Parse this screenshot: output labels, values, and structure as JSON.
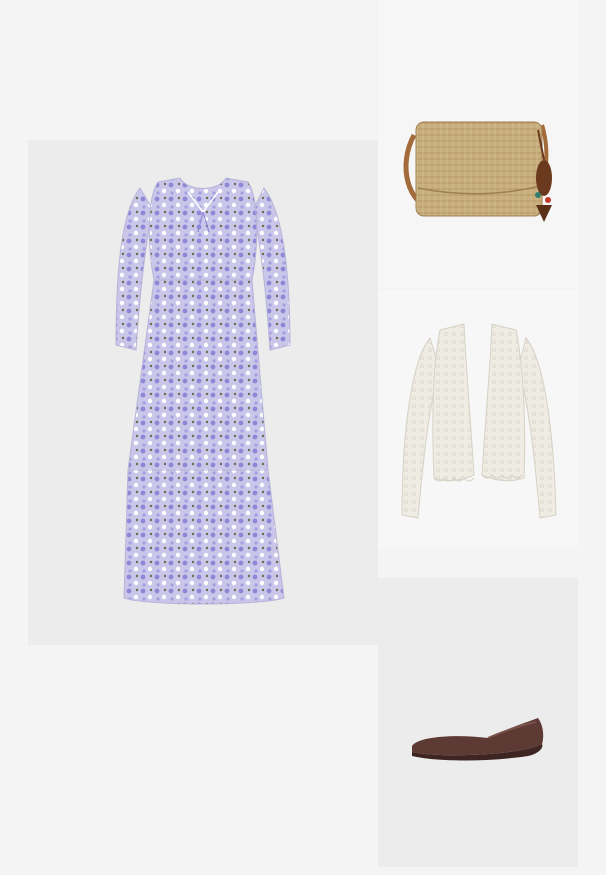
{
  "outfit": {
    "items": [
      {
        "id": "dress",
        "icon": "floral-midi-dress-image",
        "colors": {
          "base": "#c9c6ea",
          "print": "#8f86d6",
          "accent": "#ffffff"
        }
      },
      {
        "id": "bag",
        "icon": "straw-crossbody-bag-image",
        "colors": {
          "straw": "#c8ae7c",
          "strap": "#a36a3a",
          "tassel": "#6b3a1e"
        }
      },
      {
        "id": "cardigan",
        "icon": "crochet-cardigan-image",
        "colors": {
          "knit": "#efece4",
          "shade": "#dcd8cd"
        }
      },
      {
        "id": "shoe",
        "icon": "ballet-flat-image",
        "colors": {
          "upper": "#5e3a35",
          "sole": "#3e2522"
        }
      }
    ]
  }
}
